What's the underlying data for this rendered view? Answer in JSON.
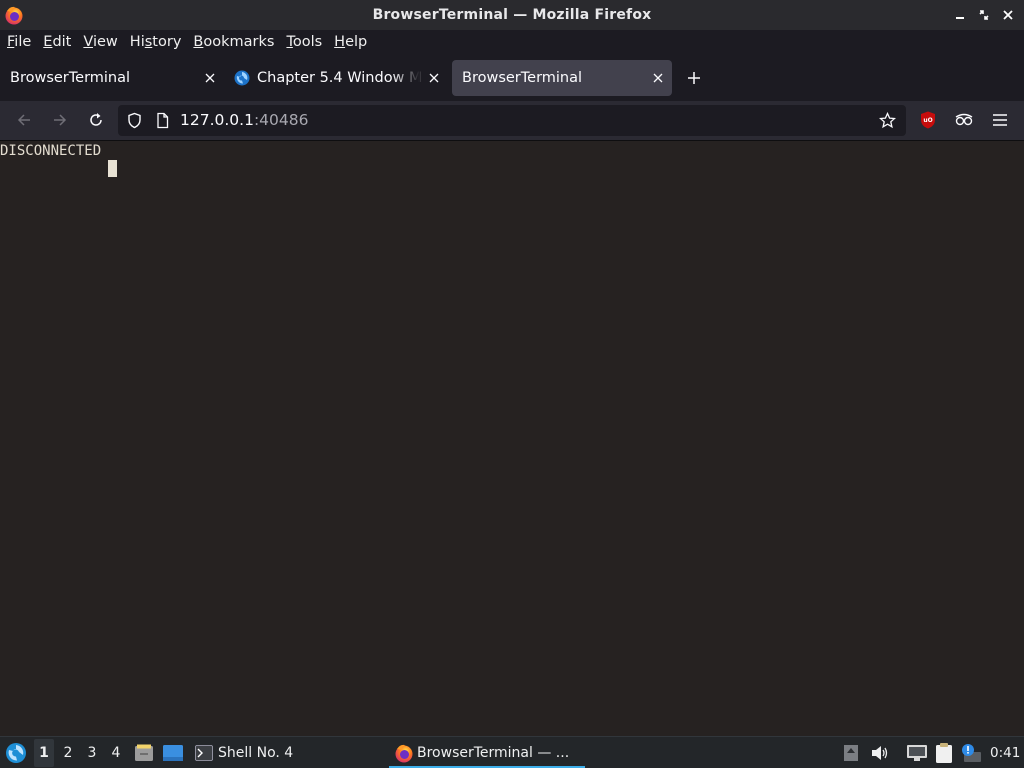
{
  "window": {
    "title": "BrowserTerminal — Mozilla Firefox"
  },
  "menubar": {
    "items": [
      {
        "label": "File",
        "ul": "F",
        "rest": "ile"
      },
      {
        "label": "Edit",
        "ul": "E",
        "rest": "dit"
      },
      {
        "label": "View",
        "ul": "V",
        "rest": "iew"
      },
      {
        "label": "History",
        "pre": "Hi",
        "ul": "s",
        "rest": "tory"
      },
      {
        "label": "Bookmarks",
        "ul": "B",
        "rest": "ookmarks"
      },
      {
        "label": "Tools",
        "ul": "T",
        "rest": "ools"
      },
      {
        "label": "Help",
        "ul": "H",
        "rest": "elp"
      }
    ]
  },
  "tabs": [
    {
      "label": "BrowserTerminal",
      "active": false
    },
    {
      "label": "Chapter 5.4 Window M",
      "active": false
    },
    {
      "label": "BrowserTerminal",
      "active": true
    }
  ],
  "urlbar": {
    "host": "127.0.0.1",
    "port": ":40486"
  },
  "terminal": {
    "line1": "DISCONNECTED"
  },
  "taskbar": {
    "workspaces": [
      "1",
      "2",
      "3",
      "4"
    ],
    "active_workspace": "1",
    "tasks": [
      {
        "label": "Shell No. 4"
      },
      {
        "label": "BrowserTerminal — ..."
      }
    ],
    "clock": "0:41"
  },
  "colors": {
    "accent": "#3daee9",
    "ublock": "#c70d0d",
    "content_bg": "#262221"
  }
}
